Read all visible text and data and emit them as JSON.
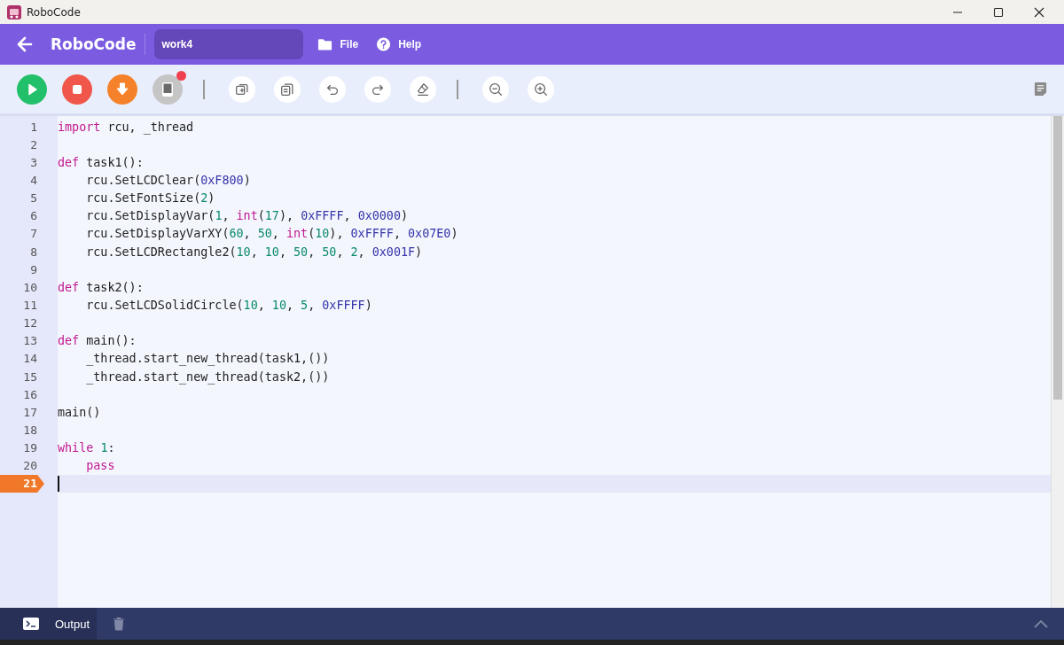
{
  "window": {
    "title": "RoboCode"
  },
  "header": {
    "app_name": "RoboCode",
    "project_name": "work4",
    "menus": [
      {
        "kind": "file",
        "label": "File"
      },
      {
        "kind": "help",
        "label": "Help"
      }
    ]
  },
  "toolbar": {
    "device_alert": true,
    "buttons": [
      {
        "kind": "run"
      },
      {
        "kind": "stop"
      },
      {
        "kind": "download"
      },
      {
        "kind": "device"
      },
      {
        "kind": "sep"
      },
      {
        "kind": "copy-add"
      },
      {
        "kind": "copy"
      },
      {
        "kind": "undo"
      },
      {
        "kind": "redo"
      },
      {
        "kind": "erase"
      },
      {
        "kind": "sep"
      },
      {
        "kind": "zoom-out"
      },
      {
        "kind": "zoom-in"
      }
    ]
  },
  "editor": {
    "lines": [
      {
        "number": "1",
        "selected": false,
        "tokens": [
          {
            "kind": "keyword",
            "t": "import"
          },
          {
            "kind": "plain",
            "t": " rcu, _thread"
          }
        ]
      },
      {
        "number": "2",
        "selected": false
      },
      {
        "number": "3",
        "selected": false,
        "tokens": [
          {
            "kind": "keyword",
            "t": "def"
          },
          {
            "kind": "plain",
            "t": " task1():"
          }
        ]
      },
      {
        "number": "4",
        "selected": false,
        "tokens": [
          {
            "kind": "plain",
            "t": "    rcu.SetLCDClear("
          },
          {
            "kind": "hex",
            "t": "0xF800"
          },
          {
            "kind": "plain",
            "t": ")"
          }
        ]
      },
      {
        "number": "5",
        "selected": false,
        "tokens": [
          {
            "kind": "plain",
            "t": "    rcu.SetFontSize("
          },
          {
            "kind": "number",
            "t": "2"
          },
          {
            "kind": "plain",
            "t": ")"
          }
        ]
      },
      {
        "number": "6",
        "selected": false,
        "tokens": [
          {
            "kind": "plain",
            "t": "    rcu.SetDisplayVar("
          },
          {
            "kind": "number",
            "t": "1"
          },
          {
            "kind": "plain",
            "t": ", "
          },
          {
            "kind": "keyword",
            "t": "int"
          },
          {
            "kind": "plain",
            "t": "("
          },
          {
            "kind": "number",
            "t": "17"
          },
          {
            "kind": "plain",
            "t": "), "
          },
          {
            "kind": "hex",
            "t": "0xFFFF"
          },
          {
            "kind": "plain",
            "t": ", "
          },
          {
            "kind": "hex",
            "t": "0x0000"
          },
          {
            "kind": "plain",
            "t": ")"
          }
        ]
      },
      {
        "number": "7",
        "selected": false,
        "tokens": [
          {
            "kind": "plain",
            "t": "    rcu.SetDisplayVarXY("
          },
          {
            "kind": "number",
            "t": "60"
          },
          {
            "kind": "plain",
            "t": ", "
          },
          {
            "kind": "number",
            "t": "50"
          },
          {
            "kind": "plain",
            "t": ", "
          },
          {
            "kind": "keyword",
            "t": "int"
          },
          {
            "kind": "plain",
            "t": "("
          },
          {
            "kind": "number",
            "t": "10"
          },
          {
            "kind": "plain",
            "t": "), "
          },
          {
            "kind": "hex",
            "t": "0xFFFF"
          },
          {
            "kind": "plain",
            "t": ", "
          },
          {
            "kind": "hex",
            "t": "0x07E0"
          },
          {
            "kind": "plain",
            "t": ")"
          }
        ]
      },
      {
        "number": "8",
        "selected": false,
        "tokens": [
          {
            "kind": "plain",
            "t": "    rcu.SetLCDRectangle2("
          },
          {
            "kind": "number",
            "t": "10"
          },
          {
            "kind": "plain",
            "t": ", "
          },
          {
            "kind": "number",
            "t": "10"
          },
          {
            "kind": "plain",
            "t": ", "
          },
          {
            "kind": "number",
            "t": "50"
          },
          {
            "kind": "plain",
            "t": ", "
          },
          {
            "kind": "number",
            "t": "50"
          },
          {
            "kind": "plain",
            "t": ", "
          },
          {
            "kind": "number",
            "t": "2"
          },
          {
            "kind": "plain",
            "t": ", "
          },
          {
            "kind": "hex",
            "t": "0x001F"
          },
          {
            "kind": "plain",
            "t": ")"
          }
        ]
      },
      {
        "number": "9",
        "selected": false
      },
      {
        "number": "10",
        "selected": false,
        "tokens": [
          {
            "kind": "keyword",
            "t": "def"
          },
          {
            "kind": "plain",
            "t": " task2():"
          }
        ]
      },
      {
        "number": "11",
        "selected": false,
        "tokens": [
          {
            "kind": "plain",
            "t": "    rcu.SetLCDSolidCircle("
          },
          {
            "kind": "number",
            "t": "10"
          },
          {
            "kind": "plain",
            "t": ", "
          },
          {
            "kind": "number",
            "t": "10"
          },
          {
            "kind": "plain",
            "t": ", "
          },
          {
            "kind": "number",
            "t": "5"
          },
          {
            "kind": "plain",
            "t": ", "
          },
          {
            "kind": "hex",
            "t": "0xFFFF"
          },
          {
            "kind": "plain",
            "t": ")"
          }
        ]
      },
      {
        "number": "12",
        "selected": false
      },
      {
        "number": "13",
        "selected": false,
        "tokens": [
          {
            "kind": "keyword",
            "t": "def"
          },
          {
            "kind": "plain",
            "t": " main():"
          }
        ]
      },
      {
        "number": "14",
        "selected": false,
        "tokens": [
          {
            "kind": "plain",
            "t": "    _thread.start_new_thread(task1,())"
          }
        ]
      },
      {
        "number": "15",
        "selected": false,
        "tokens": [
          {
            "kind": "plain",
            "t": "    _thread.start_new_thread(task2,())"
          }
        ]
      },
      {
        "number": "16",
        "selected": false
      },
      {
        "number": "17",
        "selected": false,
        "tokens": [
          {
            "kind": "plain",
            "t": "main()"
          }
        ]
      },
      {
        "number": "18",
        "selected": false
      },
      {
        "number": "19",
        "selected": false,
        "tokens": [
          {
            "kind": "keyword",
            "t": "while "
          },
          {
            "kind": "number",
            "t": "1"
          },
          {
            "kind": "plain",
            "t": ":"
          }
        ]
      },
      {
        "number": "20",
        "selected": false,
        "tokens": [
          {
            "kind": "keyword",
            "t": "    pass"
          }
        ]
      },
      {
        "number": "21",
        "selected": true
      }
    ]
  },
  "output_panel": {
    "tab_label": "Output",
    "expanded": false
  }
}
